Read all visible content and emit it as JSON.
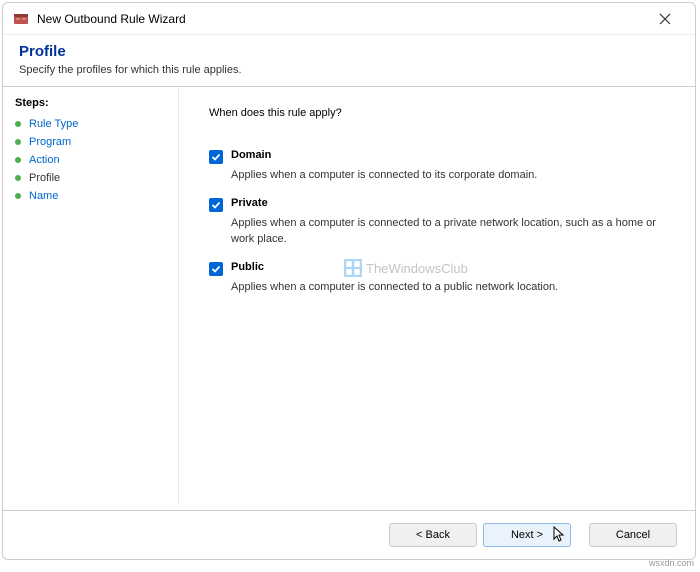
{
  "window": {
    "title": "New Outbound Rule Wizard"
  },
  "header": {
    "title": "Profile",
    "subtitle": "Specify the profiles for which this rule applies."
  },
  "sidebar": {
    "heading": "Steps:",
    "items": [
      {
        "label": "Rule Type",
        "current": false
      },
      {
        "label": "Program",
        "current": false
      },
      {
        "label": "Action",
        "current": false
      },
      {
        "label": "Profile",
        "current": true
      },
      {
        "label": "Name",
        "current": false
      }
    ]
  },
  "content": {
    "question": "When does this rule apply?",
    "options": [
      {
        "label": "Domain",
        "checked": true,
        "desc": "Applies when a computer is connected to its corporate domain."
      },
      {
        "label": "Private",
        "checked": true,
        "desc": "Applies when a computer is connected to a private network location, such as a home or work place."
      },
      {
        "label": "Public",
        "checked": true,
        "desc": "Applies when a computer is connected to a public network location."
      }
    ]
  },
  "buttons": {
    "back": "< Back",
    "next": "Next >",
    "cancel": "Cancel"
  },
  "watermark": {
    "text": "TheWindowsClub"
  },
  "attribution": "wsxdn.com"
}
